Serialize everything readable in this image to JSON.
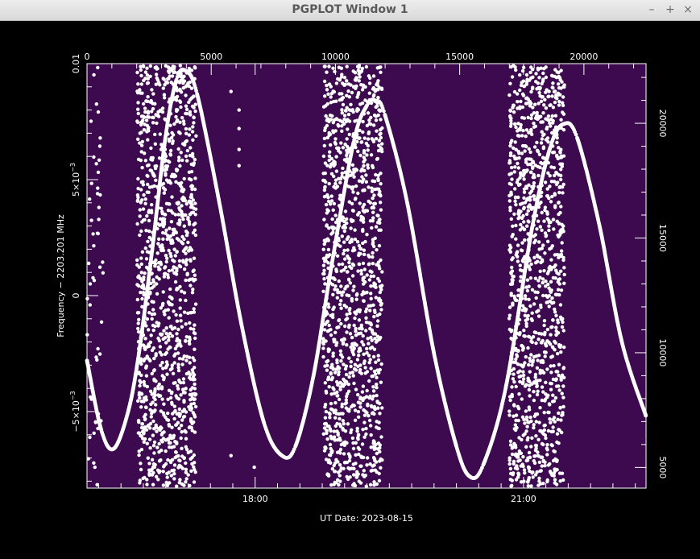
{
  "window": {
    "title": "PGPLOT Window 1",
    "controls": {
      "minimize": "–",
      "maximize": "+",
      "close": "×"
    }
  },
  "colors": {
    "background": "#000000",
    "plot_background": "#3d0a4f",
    "marker": "#ffffff",
    "titlebar": "#e4e4e4"
  },
  "chart_data": {
    "type": "scatter",
    "xlabel": "UT Date: 2023-08-15",
    "ylabel": "Frequency − 2203.201  MHz",
    "x_bottom": {
      "unit": "hours UT",
      "ticks": [
        {
          "value": 18.0,
          "label": "18:00"
        },
        {
          "value": 21.0,
          "label": "21:00"
        }
      ],
      "range": [
        16.12,
        22.37
      ]
    },
    "x_top": {
      "ticks": [
        0,
        5000,
        10000,
        15000,
        20000
      ],
      "range": [
        0,
        22500
      ]
    },
    "y_left": {
      "ticks": [
        {
          "value": 0.01,
          "label": "0.01"
        },
        {
          "value": 0.005,
          "label": "5×10",
          "exponent": "−3"
        },
        {
          "value": 0,
          "label": "0"
        },
        {
          "value": -0.005,
          "label": "−5×10",
          "exponent": "−3"
        }
      ],
      "range": [
        -0.0083,
        0.01
      ]
    },
    "y_right": {
      "ticks": [
        5000,
        10000,
        15000,
        20000
      ],
      "range": [
        4100,
        22600
      ]
    },
    "signal_series": [
      {
        "x": 16.12,
        "y": -0.0028
      },
      {
        "x": 16.28,
        "y": -0.0058
      },
      {
        "x": 16.42,
        "y": -0.0066
      },
      {
        "x": 16.58,
        "y": -0.005
      },
      {
        "x": 16.7,
        "y": -0.0025
      },
      {
        "x": 16.85,
        "y": 0.002
      },
      {
        "x": 17.0,
        "y": 0.0069
      },
      {
        "x": 17.12,
        "y": 0.0093
      },
      {
        "x": 17.22,
        "y": 0.0097
      },
      {
        "x": 17.35,
        "y": 0.0087
      },
      {
        "x": 17.6,
        "y": 0.004
      },
      {
        "x": 17.85,
        "y": -0.0013
      },
      {
        "x": 18.1,
        "y": -0.0055
      },
      {
        "x": 18.3,
        "y": -0.0069
      },
      {
        "x": 18.45,
        "y": -0.0065
      },
      {
        "x": 18.65,
        "y": -0.0035
      },
      {
        "x": 18.85,
        "y": 0.0012
      },
      {
        "x": 19.1,
        "y": 0.0066
      },
      {
        "x": 19.25,
        "y": 0.0082
      },
      {
        "x": 19.35,
        "y": 0.0084
      },
      {
        "x": 19.45,
        "y": 0.0078
      },
      {
        "x": 19.7,
        "y": 0.004
      },
      {
        "x": 20.0,
        "y": -0.0025
      },
      {
        "x": 20.25,
        "y": -0.0065
      },
      {
        "x": 20.4,
        "y": -0.0078
      },
      {
        "x": 20.55,
        "y": -0.0073
      },
      {
        "x": 20.8,
        "y": -0.004
      },
      {
        "x": 21.1,
        "y": 0.003
      },
      {
        "x": 21.3,
        "y": 0.0064
      },
      {
        "x": 21.45,
        "y": 0.0074
      },
      {
        "x": 21.6,
        "y": 0.0068
      },
      {
        "x": 21.85,
        "y": 0.003
      },
      {
        "x": 22.1,
        "y": -0.002
      },
      {
        "x": 22.37,
        "y": -0.0052
      }
    ],
    "noise_bands": [
      {
        "x_start": 16.12,
        "x_end": 16.3,
        "density": "sparse"
      },
      {
        "x_start": 16.68,
        "x_end": 17.34,
        "density": "dense"
      },
      {
        "x_start": 18.76,
        "x_end": 19.42,
        "density": "dense"
      },
      {
        "x_start": 20.84,
        "x_end": 21.46,
        "density": "dense"
      }
    ],
    "stray_points": [
      {
        "x": 17.73,
        "y": 0.0088
      },
      {
        "x": 17.82,
        "y": 0.008
      },
      {
        "x": 17.82,
        "y": 0.0072
      },
      {
        "x": 17.82,
        "y": 0.0063
      },
      {
        "x": 17.82,
        "y": 0.0056
      },
      {
        "x": 17.73,
        "y": -0.0069
      },
      {
        "x": 17.99,
        "y": -0.0074
      }
    ],
    "grid": false,
    "legend": "none"
  }
}
